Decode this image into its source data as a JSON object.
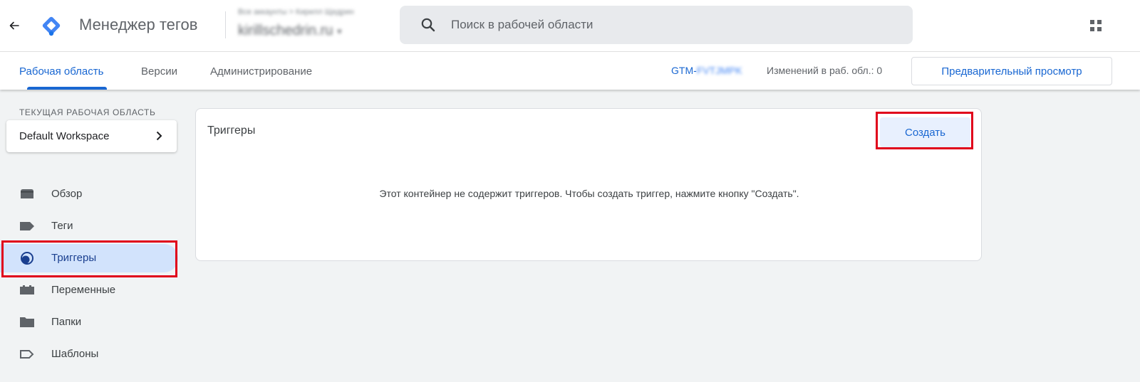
{
  "header": {
    "app_title": "Менеджер тегов",
    "account_path": "Все аккаунты > Кирилл Щедрин",
    "account_name": "kirillschedrin.ru",
    "search_placeholder": "Поиск в рабочей области"
  },
  "nav": {
    "tabs": [
      {
        "label": "Рабочая область",
        "active": true
      },
      {
        "label": "Версии",
        "active": false
      },
      {
        "label": "Администрирование",
        "active": false
      }
    ],
    "gtm_prefix": "GTM-",
    "gtm_suffix": "FVTJMPK",
    "changes": "Изменений в раб. обл.: 0",
    "preview_label": "Предварительный просмотр"
  },
  "sidebar": {
    "workspace_label": "ТЕКУЩАЯ РАБОЧАЯ ОБЛАСТЬ",
    "workspace_name": "Default Workspace",
    "items": [
      {
        "label": "Обзор",
        "icon": "overview-icon",
        "active": false
      },
      {
        "label": "Теги",
        "icon": "tag-icon",
        "active": false
      },
      {
        "label": "Триггеры",
        "icon": "trigger-icon",
        "active": true
      },
      {
        "label": "Переменные",
        "icon": "variable-icon",
        "active": false
      },
      {
        "label": "Папки",
        "icon": "folder-icon",
        "active": false
      },
      {
        "label": "Шаблоны",
        "icon": "template-icon",
        "active": false
      }
    ]
  },
  "main": {
    "title": "Триггеры",
    "create_label": "Создать",
    "empty_message": "Этот контейнер не содержит триггеров. Чтобы создать триггер, нажмите кнопку \"Создать\"."
  },
  "colors": {
    "accent": "#1967d2",
    "highlight": "#e0001b",
    "active_nav_bg": "#d2e3fc",
    "page_bg": "#f1f3f4"
  }
}
